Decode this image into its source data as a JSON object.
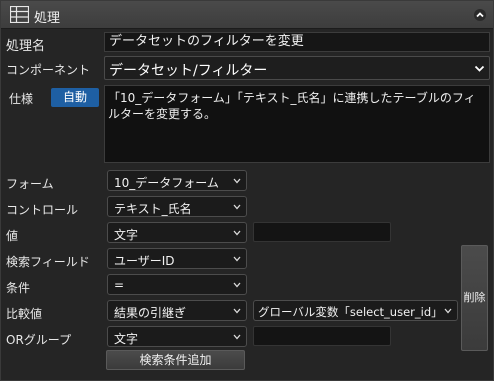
{
  "header": {
    "title": "処理",
    "icon": "table-grid-icon"
  },
  "fields": {
    "process_name_label": "処理名",
    "process_name_value": "データセットのフィルターを変更",
    "component_label": "コンポーネント",
    "component_value": "データセット/フィルター",
    "spec_label": "仕様",
    "auto_badge": "自動",
    "spec_text": "「10_データフォーム」「テキスト_氏名」に連携したテーブルのフィルターを変更する。"
  },
  "rows": {
    "form": {
      "label": "フォーム",
      "value": "10_データフォーム"
    },
    "control": {
      "label": "コントロール",
      "value": "テキスト_氏名"
    },
    "value": {
      "label": "値",
      "value": "文字"
    },
    "search_field": {
      "label": "検索フィールド",
      "value": "ユーザーID"
    },
    "condition": {
      "label": "条件",
      "value": "="
    },
    "compare_value": {
      "label": "比較値",
      "value": "結果の引継ぎ",
      "secondary_value": "グローバル変数「select_user_id」取得"
    },
    "or_group": {
      "label": "ORグループ",
      "value": "文字"
    }
  },
  "buttons": {
    "delete": "削除",
    "add_condition": "検索条件追加"
  },
  "colors": {
    "background": "#252525",
    "header": "#434343",
    "accent_badge": "#1e5fa3",
    "field": "#161616"
  }
}
